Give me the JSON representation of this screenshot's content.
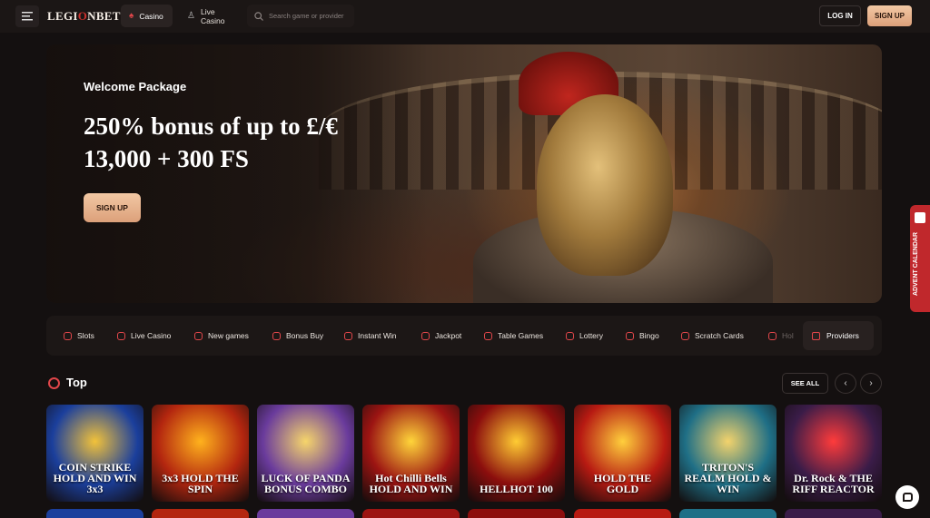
{
  "header": {
    "logo_prefix": "LEGI",
    "logo_o": "O",
    "logo_suffix": "NBET",
    "nav": [
      {
        "label": "Casino",
        "icon": "spade-icon",
        "active": true
      },
      {
        "label": "Live Casino",
        "icon": "dealer-icon",
        "active": false
      }
    ],
    "search_placeholder": "Search game or provider",
    "login_label": "LOG IN",
    "signup_label": "SIGN UP"
  },
  "hero": {
    "kicker": "Welcome Package",
    "title": "250% bonus of up to £/€ 13,000 + 300 FS",
    "cta_label": "SIGN UP"
  },
  "advent": {
    "label": "ADVENT CALENDAR"
  },
  "categories": [
    {
      "label": "Slots",
      "icon": "cherries-icon"
    },
    {
      "label": "Live Casino",
      "icon": "dealer-icon"
    },
    {
      "label": "New games",
      "icon": "bolt-icon"
    },
    {
      "label": "Bonus Buy",
      "icon": "gift-icon"
    },
    {
      "label": "Instant Win",
      "icon": "rocket-icon"
    },
    {
      "label": "Jackpot",
      "icon": "moneybag-icon"
    },
    {
      "label": "Table Games",
      "icon": "cards-icon"
    },
    {
      "label": "Lottery",
      "icon": "ticket-icon"
    },
    {
      "label": "Bingo",
      "icon": "bingo-ball-icon"
    },
    {
      "label": "Scratch Cards",
      "icon": "scratch-icon"
    },
    {
      "label": "Hol",
      "icon": "holiday-icon"
    }
  ],
  "providers_label": "Providers",
  "section": {
    "title": "Top",
    "see_all_label": "SEE ALL",
    "prev": "‹",
    "next": "›"
  },
  "games": [
    {
      "title": "COIN STRIKE HOLD AND WIN 3x3",
      "bg": "#1b3f9c",
      "accent": "#f2c23a"
    },
    {
      "title": "3x3 HOLD THE SPIN",
      "bg": "#b3260f",
      "accent": "#ffb21d"
    },
    {
      "title": "LUCK OF PANDA BONUS COMBO",
      "bg": "#6a3b9c",
      "accent": "#f6d56b"
    },
    {
      "title": "Hot Chilli Bells HOLD AND WIN",
      "bg": "#9c1412",
      "accent": "#ffd53a"
    },
    {
      "title": "HELLHOT 100",
      "bg": "#8c0e0d",
      "accent": "#ffcc33"
    },
    {
      "title": "HOLD THE GOLD",
      "bg": "#b71a12",
      "accent": "#ffcf3c"
    },
    {
      "title": "TRITON'S REALM HOLD & WIN",
      "bg": "#1f6f86",
      "accent": "#f3d36c"
    },
    {
      "title": "Dr. Rock & THE RIFF REACTOR",
      "bg": "#3a1c48",
      "accent": "#ff3b3b"
    }
  ]
}
